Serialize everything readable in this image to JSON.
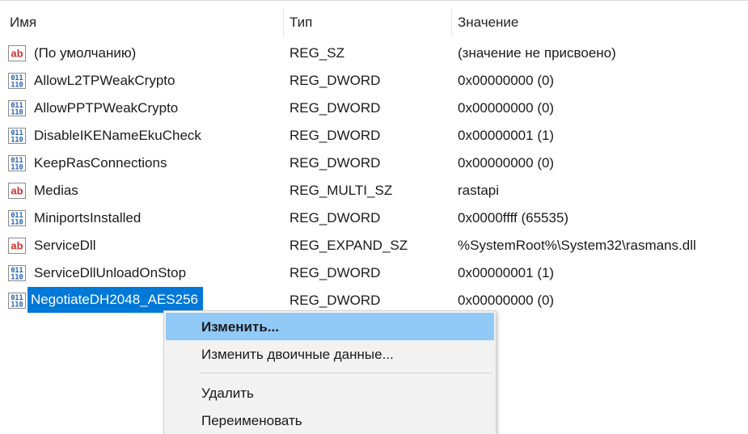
{
  "columns": {
    "name": "Имя",
    "type": "Тип",
    "value": "Значение"
  },
  "rows": [
    {
      "icon": "string-value-icon",
      "name": "(По умолчанию)",
      "type": "REG_SZ",
      "value": "(значение не присвоено)"
    },
    {
      "icon": "binary-value-icon",
      "name": "AllowL2TPWeakCrypto",
      "type": "REG_DWORD",
      "value": "0x00000000 (0)"
    },
    {
      "icon": "binary-value-icon",
      "name": "AllowPPTPWeakCrypto",
      "type": "REG_DWORD",
      "value": "0x00000000 (0)"
    },
    {
      "icon": "binary-value-icon",
      "name": "DisableIKENameEkuCheck",
      "type": "REG_DWORD",
      "value": "0x00000001 (1)"
    },
    {
      "icon": "binary-value-icon",
      "name": "KeepRasConnections",
      "type": "REG_DWORD",
      "value": "0x00000000 (0)"
    },
    {
      "icon": "string-value-icon",
      "name": "Medias",
      "type": "REG_MULTI_SZ",
      "value": "rastapi"
    },
    {
      "icon": "binary-value-icon",
      "name": "MiniportsInstalled",
      "type": "REG_DWORD",
      "value": "0x0000ffff (65535)"
    },
    {
      "icon": "string-value-icon",
      "name": "ServiceDll",
      "type": "REG_EXPAND_SZ",
      "value": "%SystemRoot%\\System32\\rasmans.dll"
    },
    {
      "icon": "binary-value-icon",
      "name": "ServiceDllUnloadOnStop",
      "type": "REG_DWORD",
      "value": "0x00000001 (1)"
    },
    {
      "icon": "binary-value-icon",
      "name": "NegotiateDH2048_AES256",
      "type": "REG_DWORD",
      "value": "0x00000000 (0)"
    }
  ],
  "context_menu": {
    "modify": "Изменить...",
    "modify_binary": "Изменить двоичные данные...",
    "delete": "Удалить",
    "rename": "Переименовать"
  },
  "colors": {
    "selection": "#0078d7",
    "menu_highlight": "#91c9f7",
    "string_icon": "#d0312d",
    "binary_icon": "#1f5fb4"
  }
}
